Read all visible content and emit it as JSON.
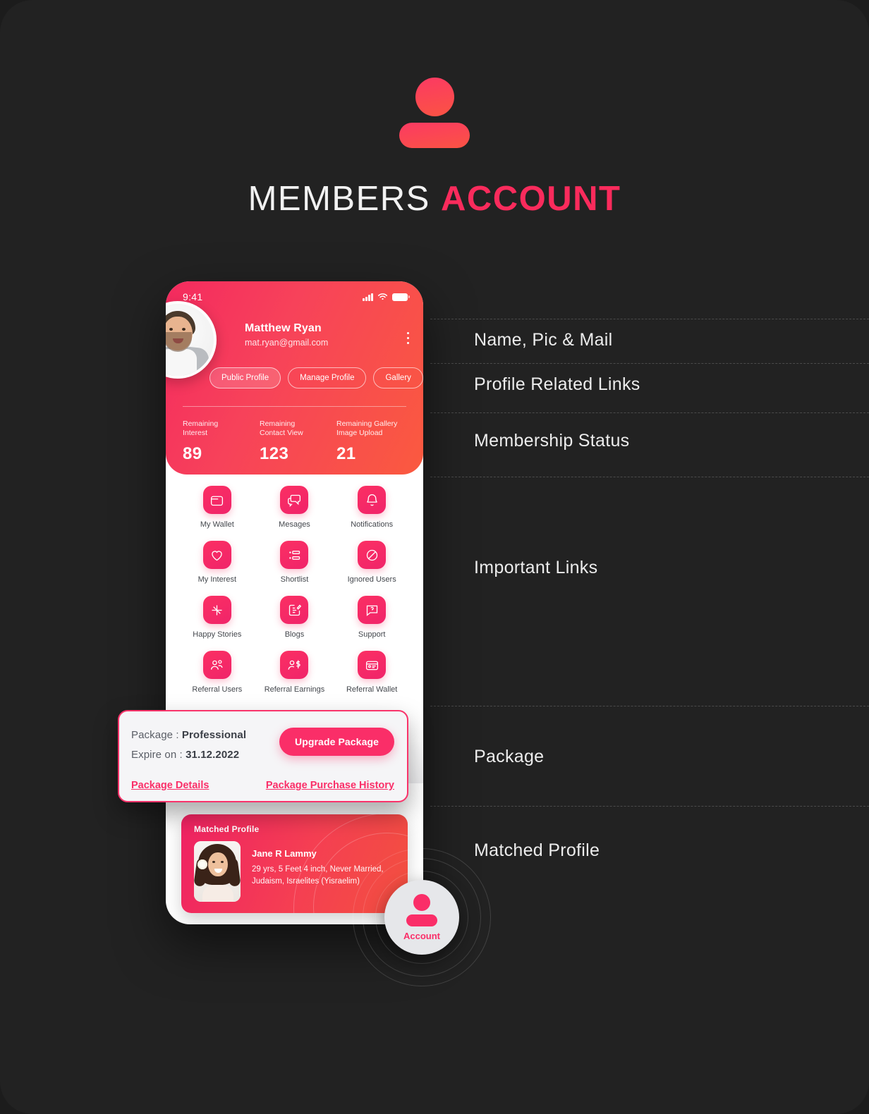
{
  "hero": {
    "icon": "person-icon",
    "title_light": "MEMBERS",
    "title_bold": "ACCOUNT"
  },
  "annotations": [
    {
      "label": "Name, Pic & Mail"
    },
    {
      "label": "Profile Related Links"
    },
    {
      "label": "Membership Status"
    },
    {
      "label": "Important Links"
    },
    {
      "label": "Package"
    },
    {
      "label": "Matched Profile"
    }
  ],
  "phone": {
    "statusbar": {
      "time": "9:41",
      "signal_icon": "signal-bars-icon",
      "wifi_icon": "wifi-icon",
      "battery_icon": "battery-full-icon"
    },
    "profile": {
      "name": "Matthew Ryan",
      "email": "mat.ryan@gmail.com",
      "avatar_alt": "profile-photo",
      "menu_icon": "kebab-menu-icon"
    },
    "chips": [
      {
        "label": "Public Profile",
        "active": true
      },
      {
        "label": "Manage Profile",
        "active": false
      },
      {
        "label": "Gallery",
        "active": false
      }
    ],
    "stats": [
      {
        "label": "Remaining\nInterest",
        "label_l1": "Remaining",
        "label_l2": "Interest",
        "value": "89"
      },
      {
        "label": "Remaining\nContact View",
        "label_l1": "Remaining",
        "label_l2": "Contact View",
        "value": "123"
      },
      {
        "label": "Remaining Gallery\nImage Upload",
        "label_l1": "Remaining Gallery",
        "label_l2": "Image Upload",
        "value": "21"
      }
    ],
    "links": [
      {
        "label": "My Wallet",
        "icon": "wallet-icon"
      },
      {
        "label": "Mesages",
        "icon": "chat-bubbles-icon"
      },
      {
        "label": "Notifications",
        "icon": "bell-icon"
      },
      {
        "label": "My Interest",
        "icon": "heart-icon"
      },
      {
        "label": "Shortlist",
        "icon": "list-icon"
      },
      {
        "label": "Ignored Users",
        "icon": "block-circle-icon"
      },
      {
        "label": "Happy Stories",
        "icon": "sparkle-plus-icon"
      },
      {
        "label": "Blogs",
        "icon": "blog-edit-icon"
      },
      {
        "label": "Support",
        "icon": "support-question-icon"
      },
      {
        "label": "Referral Users",
        "icon": "referral-users-icon"
      },
      {
        "label": "Referral Earnings",
        "icon": "referral-earnings-icon"
      },
      {
        "label": "Referral Wallet",
        "icon": "referral-wallet-icon"
      }
    ],
    "matched": {
      "title": "Matched Profile",
      "name": "Jane R Lammy",
      "details_l1": "29 yrs, 5 Feet 4 inch, Never Married,",
      "details_l2": "Judaism, Israelites (Yisraelim)",
      "photo_alt": "matched-profile-photo"
    }
  },
  "package": {
    "package_label": "Package : ",
    "package_value": "Professional",
    "expire_label": "Expire on : ",
    "expire_value": "31.12.2022",
    "upgrade_button": "Upgrade Package",
    "details_link": "Package Details",
    "history_link": "Package Purchase History"
  },
  "fab": {
    "label": "Account",
    "icon": "person-icon"
  },
  "colors": {
    "background": "#222222",
    "accent_pink": "#fa2e68",
    "accent_orange": "#fa5a3f",
    "header_gradient_from": "#f42a5f",
    "header_gradient_to": "#fa5a3f",
    "text_light": "#f2f2f2"
  }
}
